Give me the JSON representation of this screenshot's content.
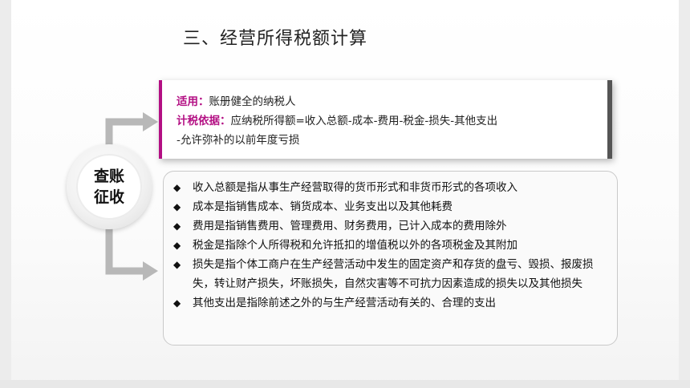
{
  "title": "三、经营所得税额计算",
  "circle": {
    "label": "查账\n征收"
  },
  "info": {
    "applicable_label": "适用：",
    "applicable_text": "账册健全的纳税人",
    "basis_label": "计税依据：",
    "basis_text": "应纳税所得额=收入总额-成本-费用-税金-损失-其他支出",
    "basis_cont": "-允许弥补的以前年度亏损"
  },
  "bullets": [
    "收入总额是指从事生产经营取得的货币形式和非货币形式的各项收入",
    "成本是指销售成本、销货成本、业务支出以及其他耗费",
    "费用是指销售费用、管理费用、财务费用，已计入成本的费用除外",
    "税金是指除个人所得税和允许抵扣的增值税以外的各项税金及其附加",
    "损失是指个体工商户在生产经营活动中发生的固定资产和存货的盘亏、毁损、报废损失，转让财产损失，坏账损失，自然灾害等不可抗力因素造成的损失以及其他损失",
    "其他支出是指除前述之外的与生产经营活动有关的、合理的支出"
  ],
  "bullet_symbol": "◆",
  "colors": {
    "accent": "#b30f83",
    "connector": "#b8b8b8"
  }
}
